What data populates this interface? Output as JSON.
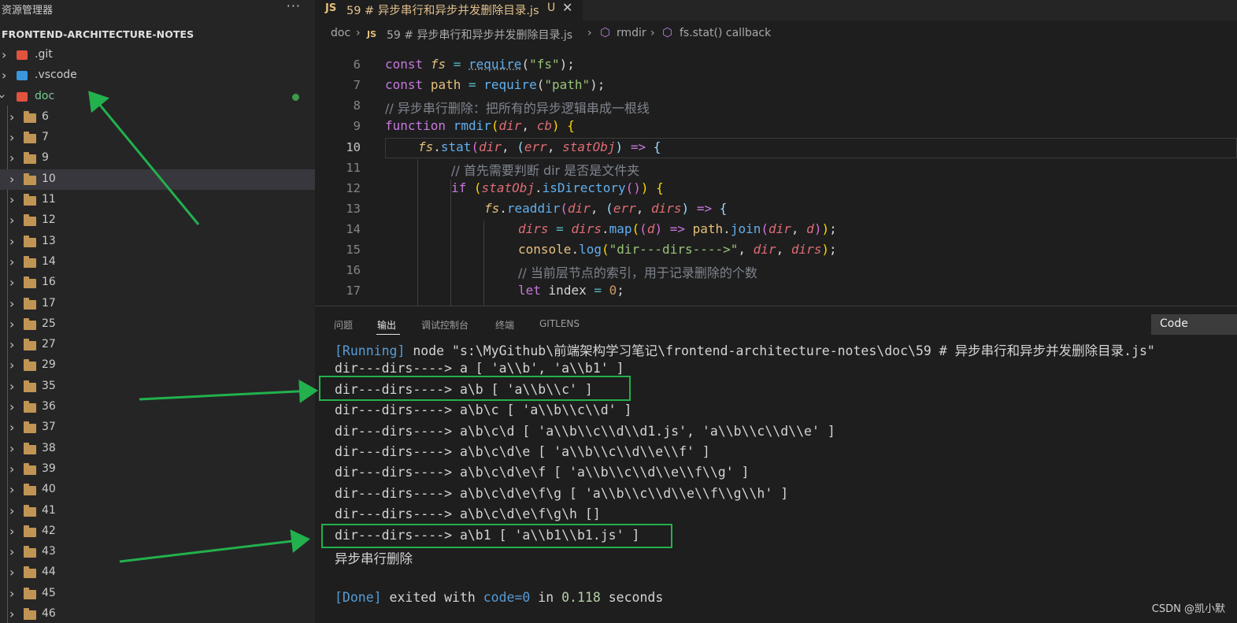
{
  "sidebar": {
    "title": "资源管理器",
    "more": "···",
    "project": "FRONTEND-ARCHITECTURE-NOTES",
    "items": [
      {
        "label": ".git",
        "kind": "git",
        "icon": "git-folder-icon"
      },
      {
        "label": ".vscode",
        "kind": "vscode",
        "icon": "vscode-folder-icon"
      },
      {
        "label": "doc",
        "kind": "doc",
        "icon": "doc-folder-icon"
      }
    ],
    "folders": [
      "6",
      "7",
      "9",
      "10",
      "11",
      "12",
      "13",
      "14",
      "16",
      "17",
      "25",
      "27",
      "29",
      "35",
      "36",
      "37",
      "38",
      "39",
      "40",
      "41",
      "42",
      "43",
      "44",
      "45",
      "46"
    ],
    "selected_folder": "10"
  },
  "editor": {
    "tab": {
      "lang_badge": "JS",
      "name": "59 # 异步串行和异步并发删除目录.js",
      "status": "U",
      "close": "✕"
    },
    "breadcrumb": {
      "root": "doc",
      "sep": "›",
      "lang_badge": "JS",
      "file": "59 # 异步串行和异步并发删除目录.js",
      "fn": "rmdir",
      "callback": "fs.stat() callback"
    },
    "line_numbers": [
      "6",
      "7",
      "8",
      "9",
      "10",
      "11",
      "12",
      "13",
      "14",
      "15",
      "16",
      "17"
    ],
    "current_line": "10"
  },
  "panel": {
    "tabs": [
      "问题",
      "输出",
      "调试控制台",
      "终端",
      "GITLENS"
    ],
    "active_tab": "输出",
    "select_value": "Code",
    "output": {
      "running_tag": "[Running]",
      "running_cmd": " node \"s:\\MyGithub\\前端架构学习笔记\\frontend-architecture-notes\\doc\\59 # 异步串行和异步并发删除目录.js\"",
      "lines": [
        "dir---dirs----> a [ 'a\\\\b', 'a\\\\b1' ]",
        "dir---dirs----> a\\b [ 'a\\\\b\\\\c' ]",
        "dir---dirs----> a\\b\\c [ 'a\\\\b\\\\c\\\\d' ]",
        "dir---dirs----> a\\b\\c\\d [ 'a\\\\b\\\\c\\\\d\\\\d1.js', 'a\\\\b\\\\c\\\\d\\\\e' ]",
        "dir---dirs----> a\\b\\c\\d\\e [ 'a\\\\b\\\\c\\\\d\\\\e\\\\f' ]",
        "dir---dirs----> a\\b\\c\\d\\e\\f [ 'a\\\\b\\\\c\\\\d\\\\e\\\\f\\\\g' ]",
        "dir---dirs----> a\\b\\c\\d\\e\\f\\g [ 'a\\\\b\\\\c\\\\d\\\\e\\\\f\\\\g\\\\h' ]",
        "dir---dirs----> a\\b\\c\\d\\e\\f\\g\\h []",
        "dir---dirs----> a\\b1 [ 'a\\\\b1\\\\b1.js' ]"
      ],
      "message": "异步串行删除",
      "done_tag": "[Done]",
      "done_pre": " exited with ",
      "done_code": "code=0",
      "done_in": " in ",
      "done_time": "0.118",
      "done_post": " seconds"
    }
  },
  "watermark": "CSDN @凯小默",
  "colors": {
    "annotation": "#22b14c",
    "accent": "#569cd6",
    "selection": "#37373d"
  }
}
